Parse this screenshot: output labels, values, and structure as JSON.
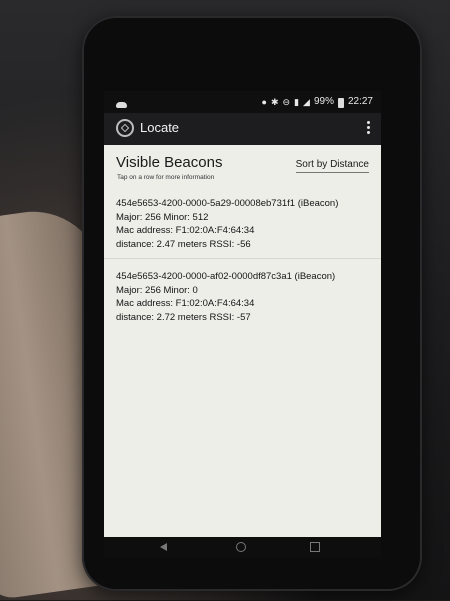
{
  "status_bar": {
    "battery": "99%",
    "time": "22:27",
    "icons": [
      "cloud-icon",
      "location-icon",
      "bluetooth-icon",
      "do-not-disturb-icon",
      "vibrate-icon",
      "signal-icon",
      "battery-icon"
    ]
  },
  "app_bar": {
    "title": "Locate",
    "logo_icon": "app-logo-icon",
    "menu_icon": "overflow-menu-icon"
  },
  "header": {
    "title": "Visible Beacons",
    "subtitle": "Tap on a row for more information",
    "sort_label": "Sort by Distance"
  },
  "beacons": [
    {
      "id_line": "454e5653-4200-0000-5a29-00008eb731f1 (iBeacon)",
      "major_minor": "Major: 256   Minor: 512",
      "mac": "Mac address: F1:02:0A:F4:64:34",
      "distance_rssi": "distance: 2.47 meters   RSSI: -56"
    },
    {
      "id_line": "454e5653-4200-0000-af02-0000df87c3a1 (iBeacon)",
      "major_minor": "Major: 256   Minor: 0",
      "mac": "Mac address: F1:02:0A:F4:64:34",
      "distance_rssi": "distance: 2.72 meters   RSSI: -57"
    }
  ],
  "nav_bar": {
    "icons": [
      "back-icon",
      "home-icon",
      "recents-icon"
    ]
  },
  "colors": {
    "content_bg": "#eeeee9",
    "app_bar_bg": "#1d1d1f",
    "text": "#141414"
  }
}
